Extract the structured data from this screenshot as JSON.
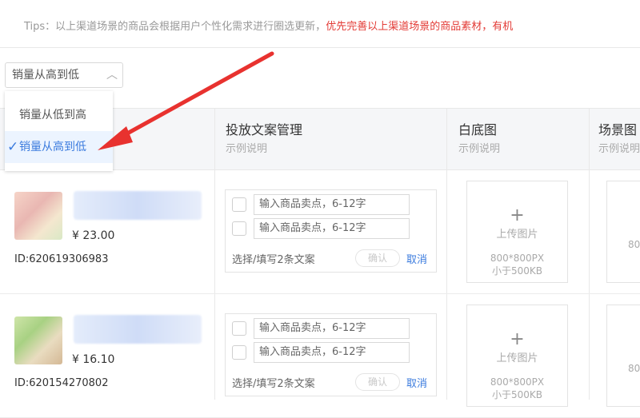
{
  "tips": {
    "prefix": "Tips：以上渠道场景的商品会根据用户个性化需求进行圈选更新，",
    "highlight": "优先完善以上渠道场景的商品素材，有机"
  },
  "sort": {
    "selected": "销量从高到低",
    "options": [
      "销量从低到高",
      "销量从高到低"
    ]
  },
  "columns": {
    "copy": {
      "title": "投放文案管理",
      "sub": "示例说明"
    },
    "white_bg": {
      "title": "白底图",
      "sub": "示例说明"
    },
    "scene": {
      "title": "场景图",
      "sub": "示例说明"
    }
  },
  "products": [
    {
      "price": "¥ 23.00",
      "id": "ID:620619306983",
      "copy_placeholder": "输入商品卖点，6-12字",
      "hint": "选择/填写2条文案",
      "confirm": "确认",
      "cancel": "取消",
      "upload_label": "上传图片",
      "upload_size": "800*800PX",
      "upload_limit": "小于500KB",
      "upload_size_partial": "80"
    },
    {
      "price": "¥ 16.10",
      "id": "ID:620154270802",
      "copy_placeholder": "输入商品卖点，6-12字",
      "hint": "选择/填写2条文案",
      "confirm": "确认",
      "cancel": "取消",
      "upload_label": "上传图片",
      "upload_size": "800*800PX",
      "upload_limit": "小于500KB",
      "upload_size_partial": "80"
    }
  ],
  "icons": {
    "chevron": "chevron-up-icon",
    "check": "check-icon",
    "plus": "plus-icon",
    "arrow": "red-arrow-annotation"
  },
  "colors": {
    "accent": "#3b7bde",
    "warning": "#e33b36",
    "arrow": "#e8322f"
  }
}
